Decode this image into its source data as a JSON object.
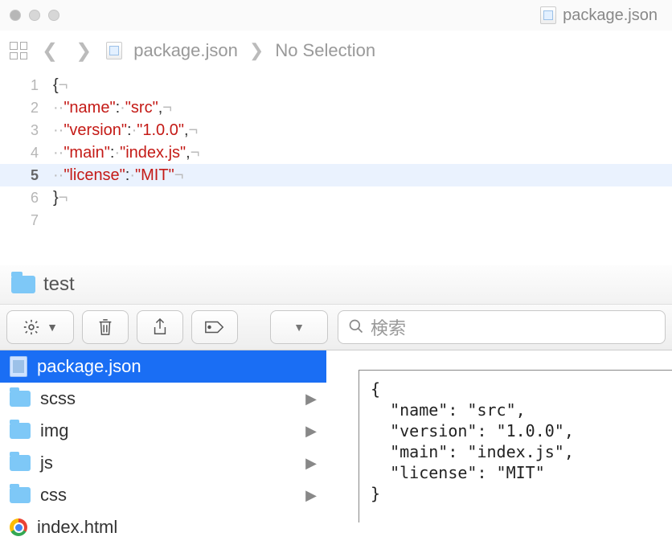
{
  "editor": {
    "title_filename": "package.json",
    "breadcrumb": {
      "file": "package.json",
      "selection": "No Selection"
    },
    "lines": [
      "1",
      "2",
      "3",
      "4",
      "5",
      "6",
      "7"
    ],
    "json": {
      "name": "src",
      "version": "1.0.0",
      "main": "index.js",
      "license": "MIT"
    },
    "highlighted_line": 5
  },
  "finder": {
    "title": "test",
    "search_placeholder": "検索",
    "items": [
      {
        "name": "package.json",
        "type": "file",
        "selected": true
      },
      {
        "name": "scss",
        "type": "folder"
      },
      {
        "name": "img",
        "type": "folder"
      },
      {
        "name": "js",
        "type": "folder"
      },
      {
        "name": "css",
        "type": "folder"
      },
      {
        "name": "index.html",
        "type": "html"
      }
    ],
    "preview_text": "{\n  \"name\": \"src\",\n  \"version\": \"1.0.0\",\n  \"main\": \"index.js\",\n  \"license\": \"MIT\"\n}"
  }
}
